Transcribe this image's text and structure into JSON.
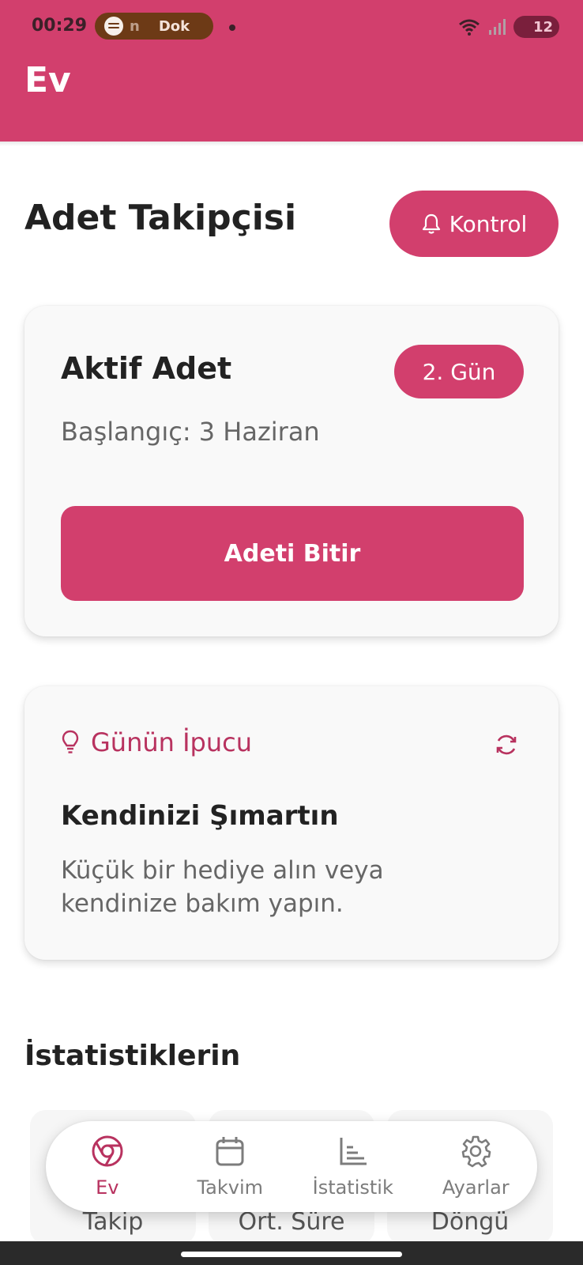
{
  "status_bar": {
    "time": "00:29",
    "media_text_a": "n",
    "media_text_b": "Dok",
    "battery": "12"
  },
  "app_bar": {
    "title": "Ev"
  },
  "header": {
    "title": "Adet Takipçisi",
    "control_button": "Kontrol"
  },
  "active_period": {
    "title": "Aktif Adet",
    "day_badge": "2. Gün",
    "start": "Başlangıç: 3 Haziran",
    "end_button": "Adeti Bitir"
  },
  "tip_of_day": {
    "heading": "Günün İpucu",
    "title": "Kendinizi Şımartın",
    "body": "Küçük bir hediye alın veya kendinize bakım yapın."
  },
  "stats": {
    "heading": "İstatistiklerin",
    "cards": [
      {
        "label": "Takip"
      },
      {
        "label": "Ort. Süre"
      },
      {
        "label": "Döngü"
      }
    ]
  },
  "bottom_nav": {
    "items": [
      {
        "label": "Ev",
        "icon": "chrome-circle-icon",
        "active": true
      },
      {
        "label": "Takvim",
        "icon": "calendar-icon",
        "active": false
      },
      {
        "label": "İstatistik",
        "icon": "bar-chart-icon",
        "active": false
      },
      {
        "label": "Ayarlar",
        "icon": "gear-icon",
        "active": false
      }
    ]
  },
  "colors": {
    "primary": "#d23f6d",
    "accent_text": "#b8325f",
    "card_bg": "#f9f9f9"
  }
}
